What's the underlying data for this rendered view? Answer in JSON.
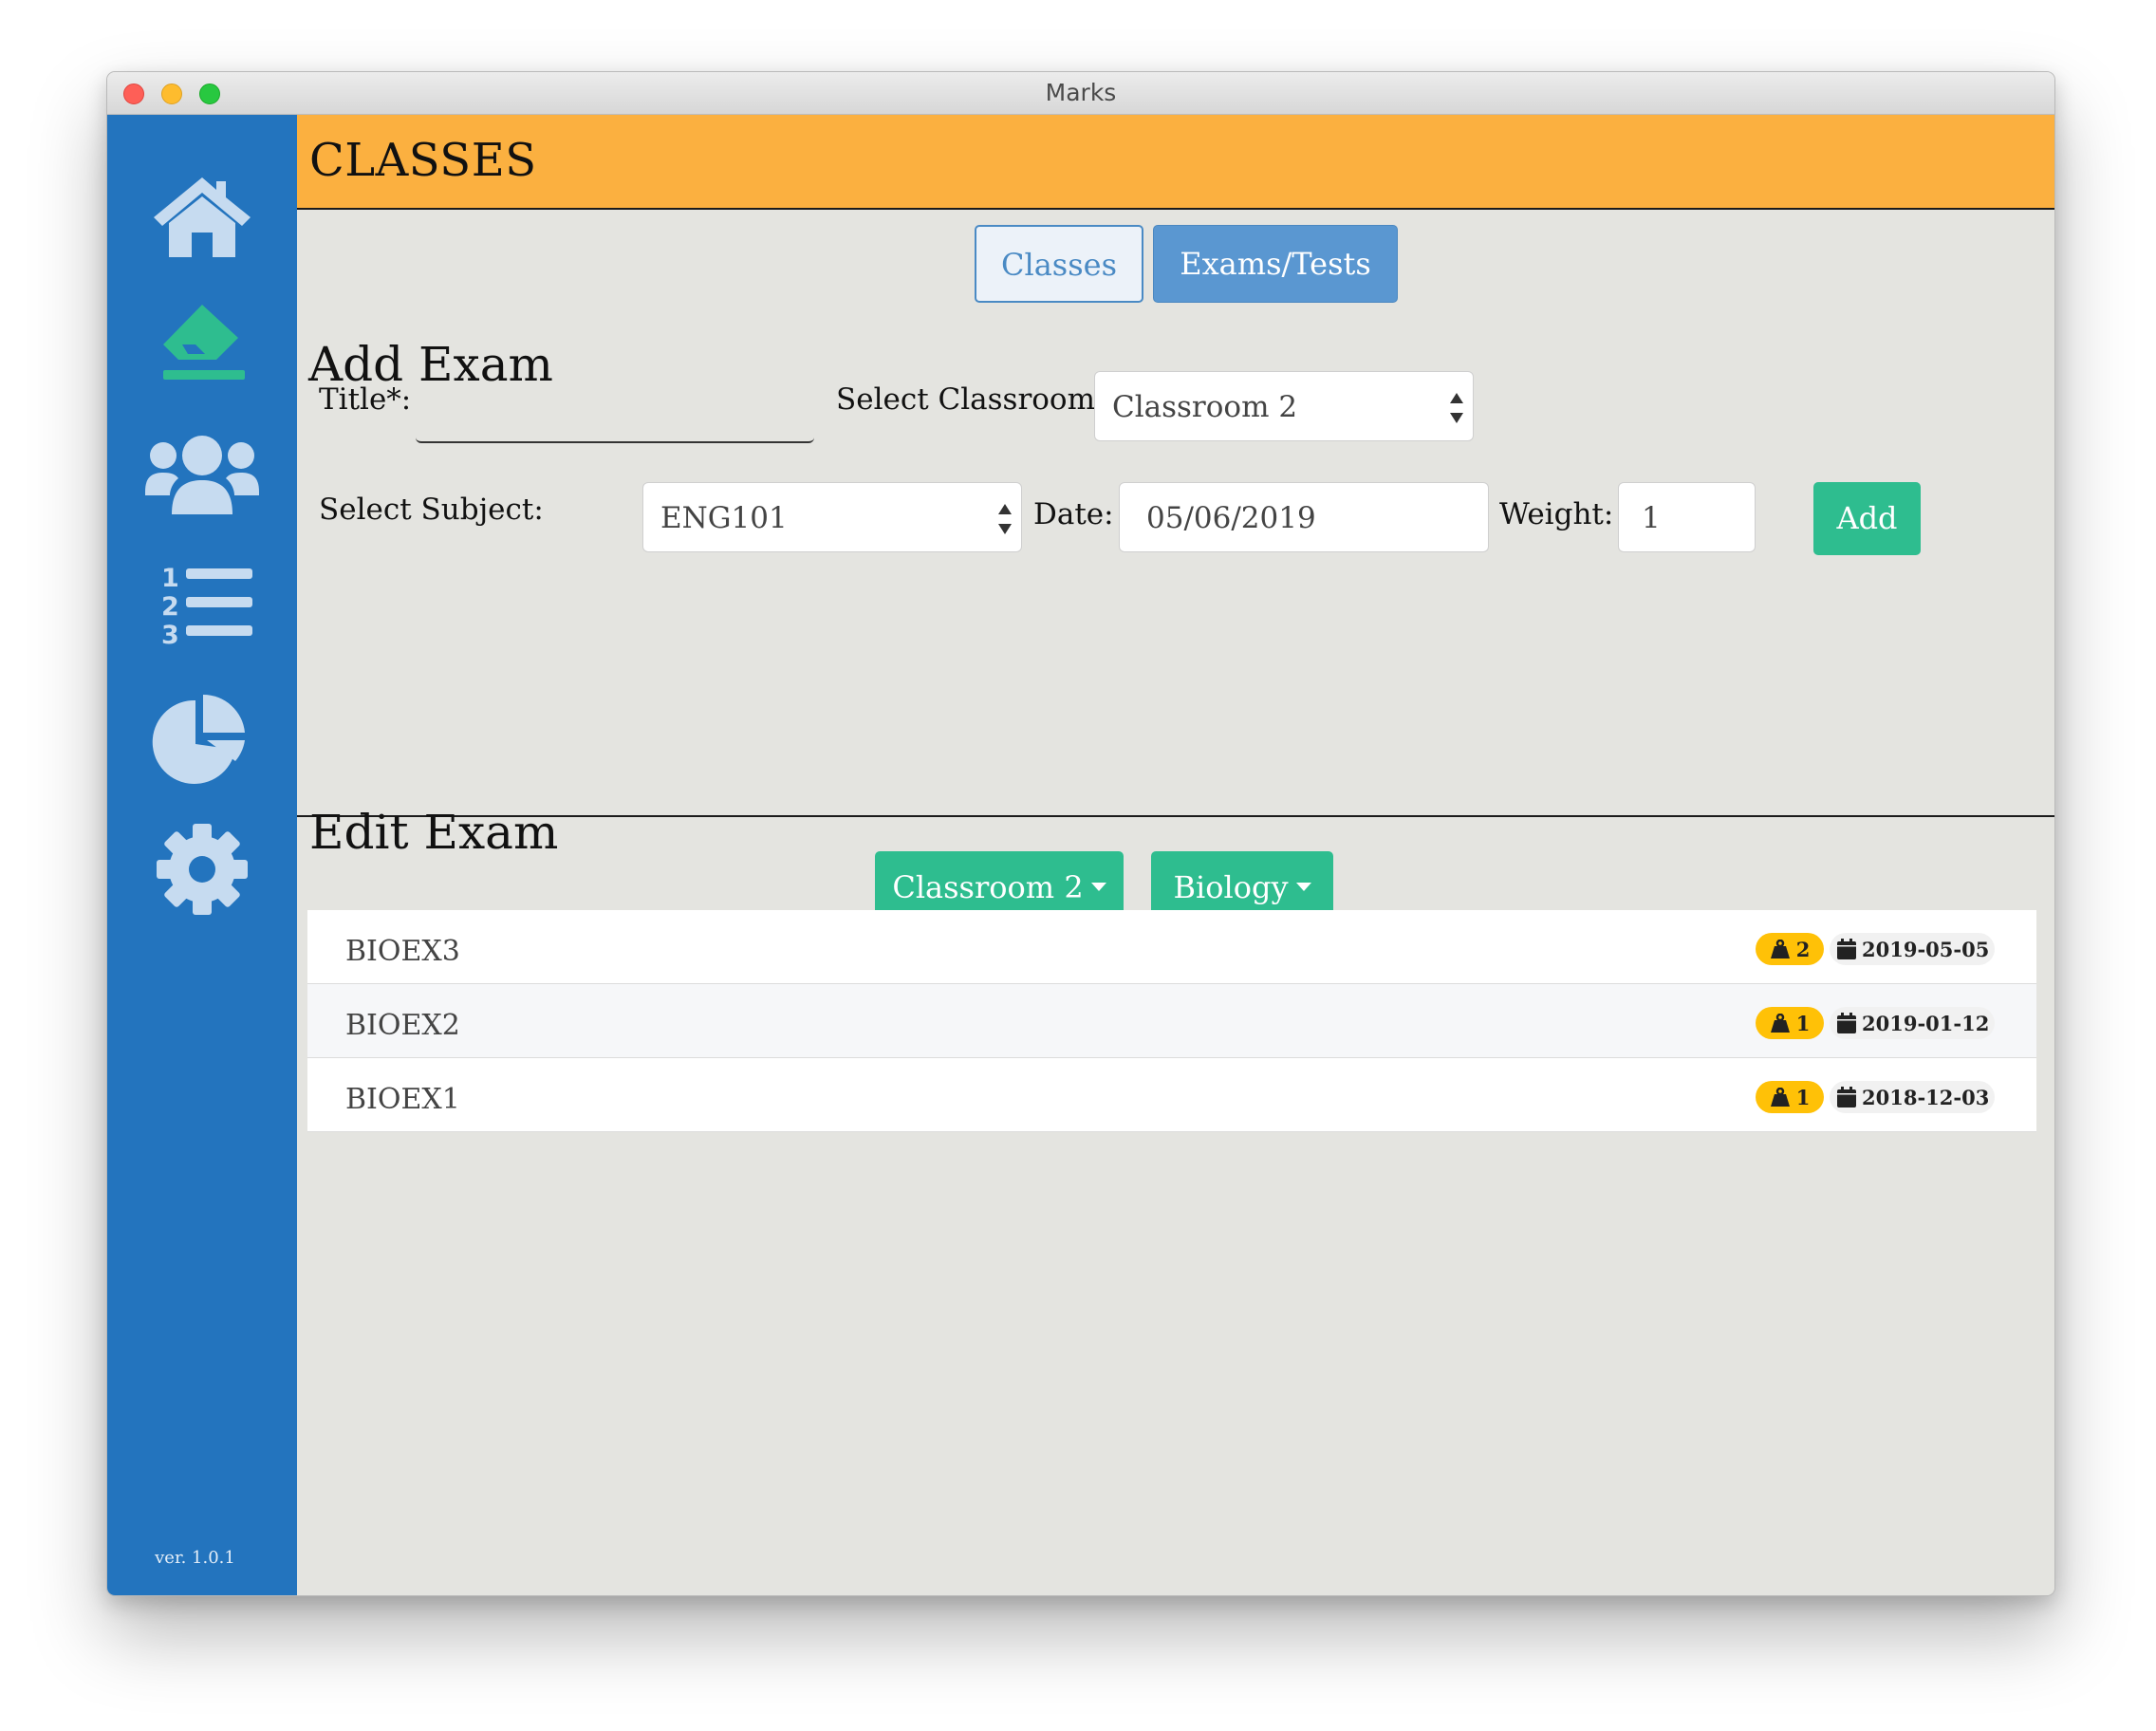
{
  "window": {
    "title": "Marks"
  },
  "colors": {
    "sidebar": "#2374be",
    "header": "#fbb040",
    "accent_green": "#2ebd8f",
    "tab_blue": "#5a97d1",
    "badge_yellow": "#ffc107"
  },
  "sidebar": {
    "items": [
      {
        "icon": "home-icon"
      },
      {
        "icon": "eraser-icon"
      },
      {
        "icon": "users-icon"
      },
      {
        "icon": "numbered-list-icon"
      },
      {
        "icon": "pie-chart-icon"
      },
      {
        "icon": "gear-icon"
      }
    ],
    "version": "ver. 1.0.1"
  },
  "header": {
    "title": "CLASSES"
  },
  "tabs": [
    {
      "label": "Classes"
    },
    {
      "label": "Exams/Tests"
    }
  ],
  "add_exam": {
    "heading": "Add Exam",
    "title_label": "Title*:",
    "title_value": "",
    "classroom_label": "Select Classroom:",
    "classroom_value": "Classroom 2",
    "subject_label": "Select Subject:",
    "subject_value": "ENG101",
    "date_label": "Date:",
    "date_value": "05/06/2019",
    "weight_label": "Weight:",
    "weight_value": "1",
    "add_label": "Add"
  },
  "edit_exam": {
    "heading": "Edit Exam",
    "classroom_filter": "Classroom 2",
    "subject_filter": "Biology",
    "exams": [
      {
        "name": "BIOEX3",
        "weight": "2",
        "date": "2019-05-05"
      },
      {
        "name": "BIOEX2",
        "weight": "1",
        "date": "2019-01-12"
      },
      {
        "name": "BIOEX1",
        "weight": "1",
        "date": "2018-12-03"
      }
    ]
  }
}
